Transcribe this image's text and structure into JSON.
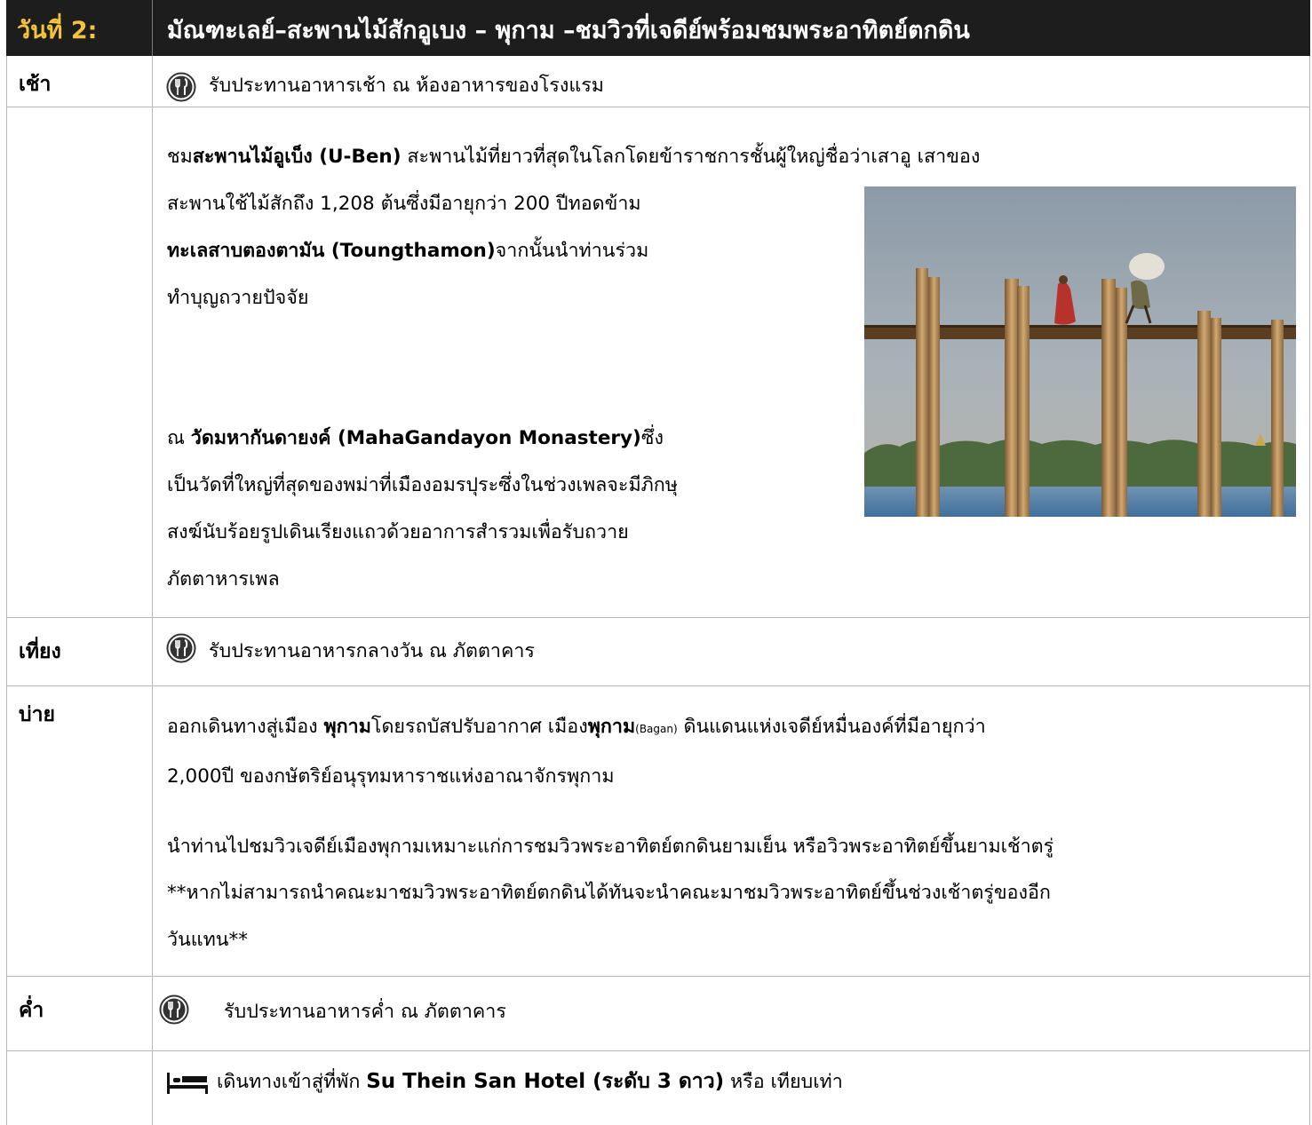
{
  "header": {
    "day": "วันที่ 2:",
    "title": "มัณฑะเลย์–สะพานไม้สักอูเบง – พุกาม  –ชมวิวที่เจดีย์พร้อมชมพระอาทิตย์ตกดิน"
  },
  "rows": {
    "breakfast": {
      "label": "เช้า",
      "icon": "meal-icon",
      "text": "รับประทานอาหารเช้า ณ ห้องอาหารของโรงแรม"
    },
    "bridge": {
      "line1_pre": "ชม",
      "line1_bold": "สะพานไม้อูเบ็ง (U-Ben)",
      "line1_post": " สะพานไม้ที่ยาวที่สุดในโลกโดยข้าราชการชั้นผู้ใหญ่ชื่อว่าเสาอู เสาของ",
      "line2": "สะพานใช้ไม้สักถึง 1,208 ต้นซึ่งมีอายุกว่า 200 ปีทอดข้าม",
      "line3_bold": "ทะเลสาบตองตามัน (Toungthamon)",
      "line3_post": "จากนั้นนำท่านร่วม",
      "line4": "ทำบุญถวายปัจจัย",
      "line5_pre": "ณ ",
      "line5_bold": "วัดมหากันดายงค์ (MahaGandayon Monastery)",
      "line5_post": "ซึ่ง",
      "line6": "เป็นวัดที่ใหญ่ที่สุดของพม่าที่เมืองอมรปุระซึ่งในช่วงเพลจะมีภิกษุ",
      "line7": "สงฆ์นับร้อยรูปเดินเรียงแถวด้วยอาการสำรวมเพื่อรับถวาย",
      "line8": "ภัตตาหารเพล"
    },
    "lunch": {
      "label": "เที่ยง",
      "icon": "meal-icon",
      "text": "รับประทานอาหารกลางวัน ณ ภัตตาคาร"
    },
    "afternoon": {
      "label": "บ่าย",
      "line1_pre": "ออกเดินทางสู่เมือง ",
      "line1_bold1": "พุกาม",
      "line1_mid": "โดยรถบัสปรับอากาศ เมือง",
      "line1_bold2": "พุกาม",
      "line1_small": "(Bagan)",
      "line1_post": " ดินแดนแห่งเจดีย์หมื่นองค์ที่มีอายุกว่า",
      "line2": "2,000ปี ของกษัตริย์อนุรุทมหาราชแห่งอาณาจักรพุกาม",
      "line3": "นำท่านไปชมวิวเจดีย์เมืองพุกามเหมาะแก่การชมวิวพระอาทิตย์ตกดินยามเย็น หรือวิวพระอาทิตย์ขึ้นยามเช้าตรู่",
      "line4": "**หากไม่สามารถนำคณะมาชมวิวพระอาทิตย์ตกดินได้ทันจะนำคณะมาชมวิวพระอาทิตย์ขึ้นช่วงเช้าตรู่ของอีก",
      "line5": "วันแทน**"
    },
    "dinner": {
      "label": "ค่ำ",
      "icon": "meal-icon",
      "text": "รับประทานอาหารค่ำ ณ ภัตตาคาร"
    },
    "hotel": {
      "icon": "bed-icon",
      "pre": "เดินทางเข้าสู่ที่พัก ",
      "bold": "Su Thein San Hotel (ระดับ 3 ดาว)",
      "post": "  หรือ เทียบเท่า"
    }
  },
  "colors": {
    "header_bg": "#1d1d1d",
    "day_label": "#f3c33c",
    "border": "#b8b8b8"
  }
}
